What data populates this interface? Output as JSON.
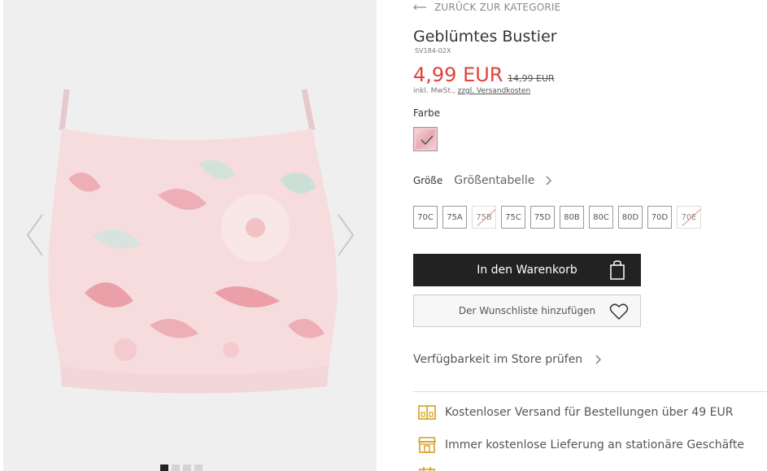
{
  "navigation": {
    "back_label": "ZURÜCK ZUR KATEGORIE"
  },
  "product": {
    "title": "Geblümtes Bustier",
    "sku": "SV184-02X",
    "price": "4,99 EUR",
    "old_price": "14,99 EUR",
    "tax_prefix": "inkl. MwSt.,",
    "tax_link": "zzgl. Versandkosten",
    "price_color": "#e2413c"
  },
  "color": {
    "label": "Farbe",
    "selected": "rosa-geblümt"
  },
  "size": {
    "label": "Größe",
    "chart_label": "Größentabelle",
    "options": [
      {
        "label": "70C",
        "available": true
      },
      {
        "label": "75A",
        "available": true
      },
      {
        "label": "75B",
        "available": false
      },
      {
        "label": "75C",
        "available": true
      },
      {
        "label": "75D",
        "available": true
      },
      {
        "label": "80B",
        "available": true
      },
      {
        "label": "80C",
        "available": true
      },
      {
        "label": "80D",
        "available": true
      },
      {
        "label": "70D",
        "available": true
      },
      {
        "label": "70E",
        "available": false
      }
    ]
  },
  "actions": {
    "cart_label": "In den Warenkorb",
    "wishlist_label": "Der Wunschliste hinzufügen",
    "store_label": "Verfügbarkeit im Store prüfen"
  },
  "benefits": [
    {
      "icon": "shipping-box-icon",
      "text": "Kostenloser Versand für Bestellungen über 49 EUR"
    },
    {
      "icon": "storefront-icon",
      "text": "Immer kostenlose Lieferung an stationäre Geschäfte"
    }
  ],
  "gallery": {
    "image_count": 4,
    "active_index": 0
  },
  "icon_color": "#d4a020"
}
